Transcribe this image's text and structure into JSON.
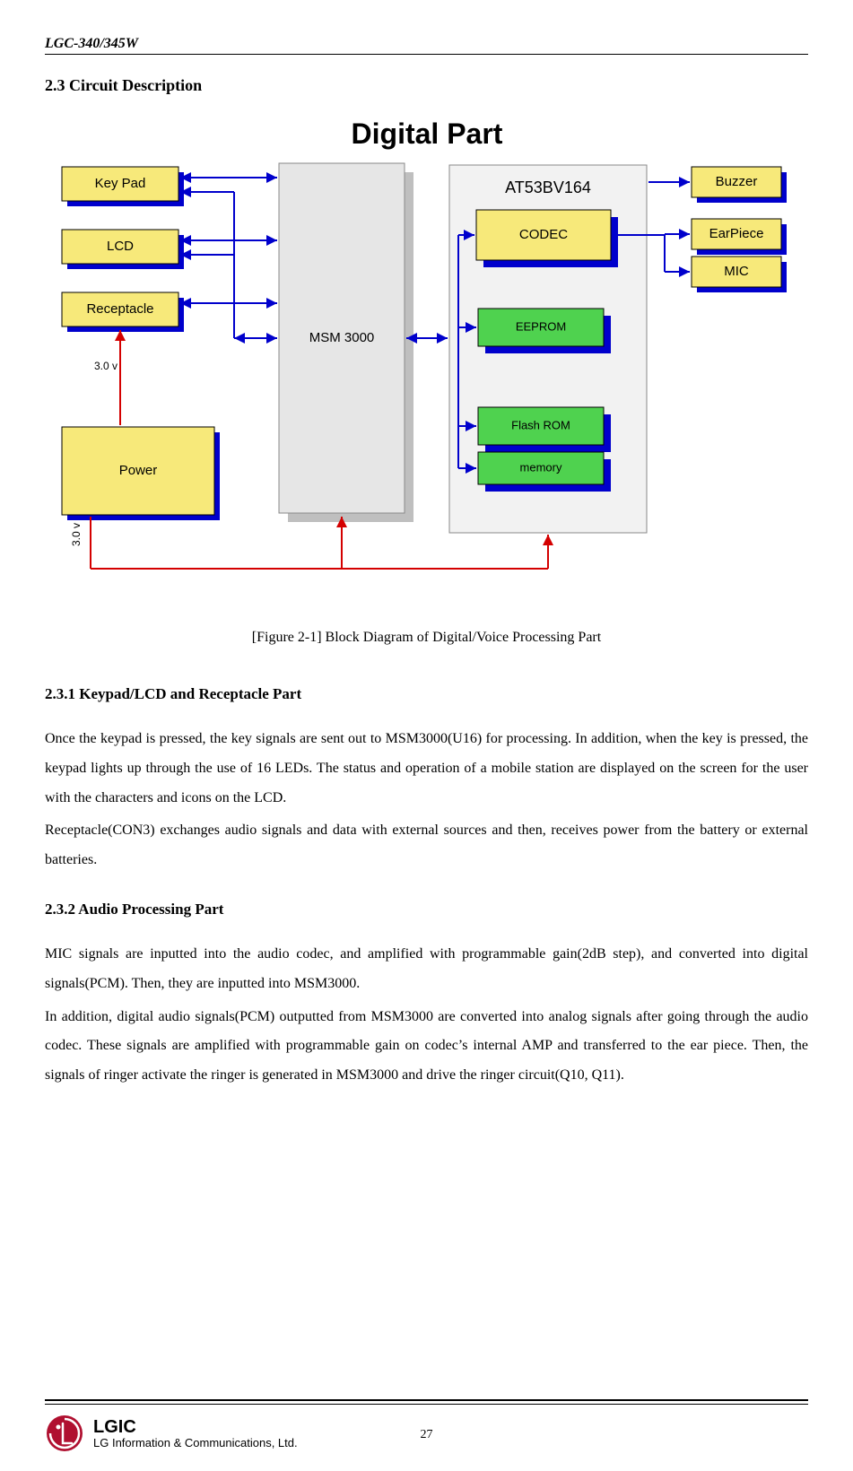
{
  "header": {
    "model": "LGC-340/345W"
  },
  "section": {
    "title": "2.3 Circuit Description"
  },
  "diagram": {
    "title": "Digital Part",
    "boxes": {
      "keypad": "Key Pad",
      "lcd": "LCD",
      "receptacle": "Receptacle",
      "power": "Power",
      "msm": "MSM 3000",
      "chip": "AT53BV164",
      "codec": "CODEC",
      "eeprom": "EEPROM",
      "flash": "Flash ROM",
      "memory": "memory",
      "buzzer": "Buzzer",
      "earpiece": "EarPiece",
      "mic": "MIC"
    },
    "labels": {
      "v30a": "3.0 v",
      "v30b": "3.0 v"
    }
  },
  "figure_caption": "[Figure 2-1] Block Diagram of Digital/Voice Processing Part",
  "subsection1": {
    "title": "2.3.1 Keypad/LCD and Receptacle Part",
    "p1": "Once the keypad is pressed, the key signals are sent out to MSM3000(U16) for processing. In addition, when the key is pressed, the keypad lights up through the use of 16 LEDs. The status and operation of a mobile station are displayed on the screen for the user with the characters and icons on the LCD.",
    "p2": "Receptacle(CON3) exchanges audio signals and data with external sources and then, receives power from the battery or external batteries."
  },
  "subsection2": {
    "title": "2.3.2 Audio Processing Part",
    "p1": "MIC signals are inputted into the audio codec, and amplified with programmable gain(2dB step), and converted into digital signals(PCM). Then, they are inputted into MSM3000.",
    "p2": "In addition, digital audio signals(PCM) outputted from MSM3000 are converted into analog signals after going through the audio codec. These signals are amplified with programmable gain on codec’s internal AMP and transferred to the ear piece. Then, the signals of ringer activate the ringer is generated in MSM3000 and drive the ringer circuit(Q10, Q11)."
  },
  "footer": {
    "lgic": "LGIC",
    "full": "LG Information & Communications, Ltd.",
    "page": "27"
  }
}
